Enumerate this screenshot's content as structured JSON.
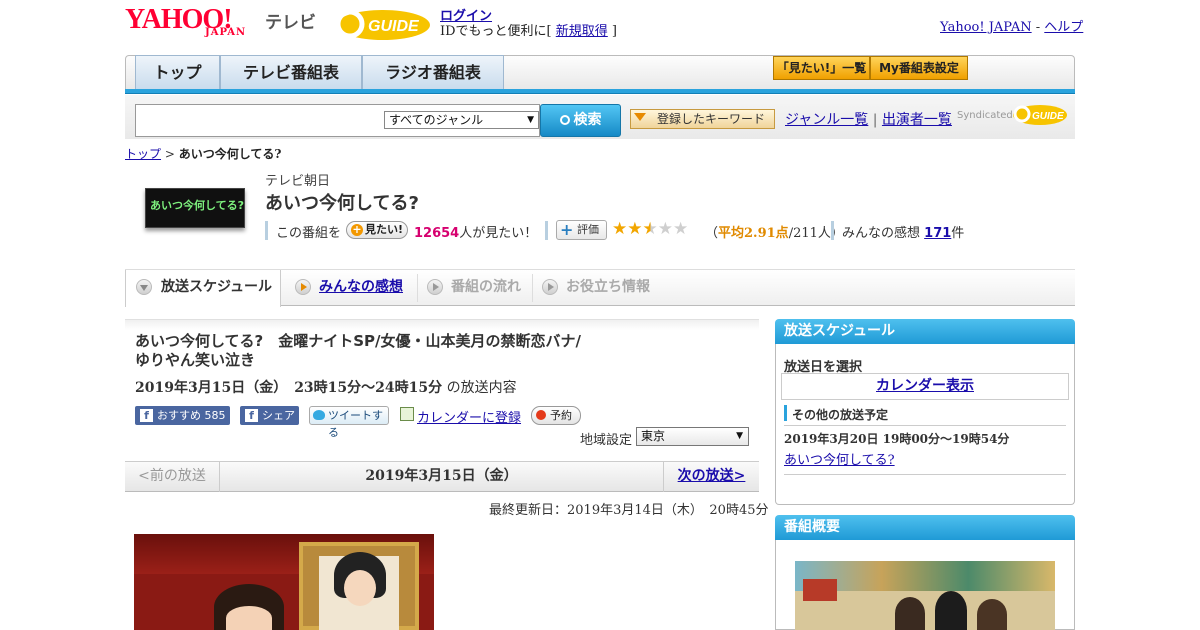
{
  "header": {
    "logo_yahoo": "YAHOO!",
    "logo_japan": "JAPAN",
    "logo_tv": "テレビ",
    "logo_gguide": "GUIDE",
    "login": "ログイン",
    "login_sub_prefix": "IDでもっと便利に[ ",
    "register": "新規取得",
    "login_sub_suffix": " ]",
    "yahoo_japan": "Yahoo! JAPAN",
    "separator": " - ",
    "help": "ヘルプ"
  },
  "nav": {
    "tabs": [
      "トップ",
      "テレビ番組表",
      "ラジオ番組表"
    ],
    "mitai_list": "「見たい!」一覧",
    "my_schedule": "My番組表設定"
  },
  "search": {
    "genre": "すべてのジャンル",
    "button": "検索",
    "keyword_button": "登録したキーワード",
    "genre_list": "ジャンル一覧",
    "link_sep": " | ",
    "cast_list": "出演者一覧",
    "syndicated": "Syndicated"
  },
  "breadcrumb": {
    "top": "トップ",
    "sep": " > ",
    "current": "あいつ今何してる?"
  },
  "program": {
    "thumb_text": "あいつ今何してる?",
    "station": "テレビ朝日",
    "title": "あいつ今何してる?",
    "want_prefix": "この番組を",
    "want_button": "見たい!",
    "want_count": "12654",
    "want_suffix": "人が見たい！",
    "rate_button": "評価",
    "rating": 2.91,
    "avg_open": "（",
    "avg_value": "平均2.91点",
    "avg_count": "/211人）",
    "impressions_label": "みんなの感想",
    "impressions_count": "171",
    "impressions_unit": "件"
  },
  "program_tabs": [
    "放送スケジュール",
    "みんなの感想",
    "番組の流れ",
    "お役立ち情報"
  ],
  "episode": {
    "title": "あいつ今何してる?　金曜ナイトSP/女優・山本美月の禁断恋バナ/ゆりやん笑い泣き",
    "date": "2019年3月15日（金）　23時15分～24時15分",
    "date_suffix": " の放送内容",
    "fb_recommend": "おすすめ 585",
    "fb_share": "シェア",
    "tweet": "ツイートする",
    "calendar": "カレンダーに登録",
    "reserve": "予約",
    "region_label": "地域設定",
    "region_value": "東京"
  },
  "pager": {
    "prev": "<前の放送",
    "current": "2019年3月15日（金）",
    "next": "次の放送>"
  },
  "updated": "最終更新日：2019年3月14日（木）　20時45分",
  "sidebar": {
    "schedule_title": "放送スケジュール",
    "select_date": "放送日を選択",
    "calendar_view": "カレンダー表示",
    "other_label": "その他の放送予定",
    "next_date": "2019年3月20日  19時00分～19時54分",
    "next_title": "あいつ今何してる?",
    "overview_title": "番組概要"
  },
  "colors": {
    "brand_red": "#ff0033",
    "accent_blue": "#2aa3dd",
    "link": "#1a0dab",
    "count_pink": "#d6006f",
    "star": "#f2a600"
  }
}
